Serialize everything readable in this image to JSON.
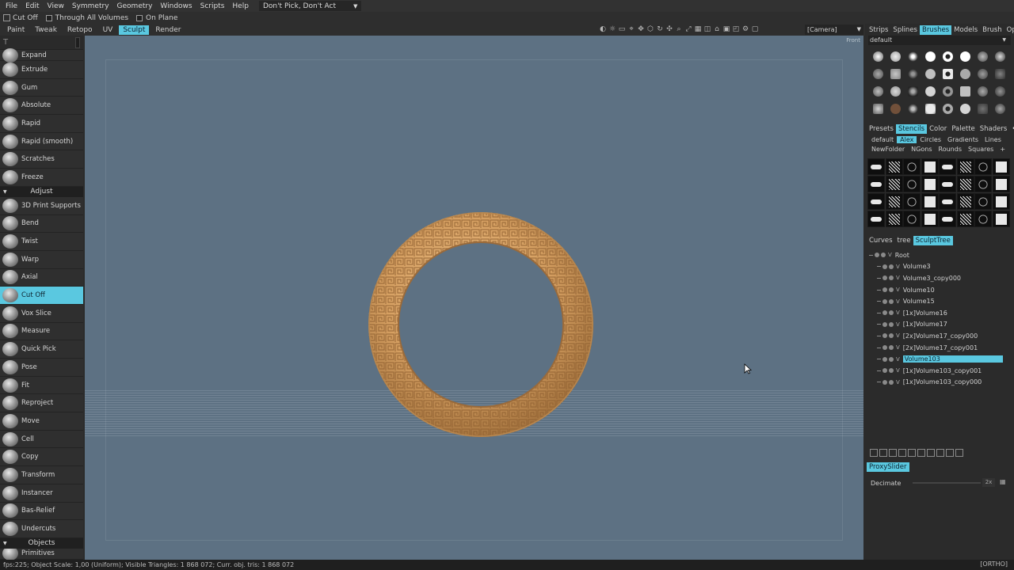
{
  "menu": {
    "items": [
      "File",
      "Edit",
      "View",
      "Symmetry",
      "Geometry",
      "Windows",
      "Scripts",
      "Help"
    ],
    "pick_mode": "Don't Pick, Don't Act"
  },
  "options": {
    "cut_off": "Cut Off",
    "through_all_volumes": "Through  All  Volumes",
    "on_plane": "On Plane"
  },
  "mode_tabs": [
    "Paint",
    "Tweak",
    "Retopo",
    "UV",
    "Sculpt",
    "Render"
  ],
  "active_mode": "Sculpt",
  "camera": "[Camera]",
  "viewport": {
    "view_label": "Front",
    "object_color": "#d6a062",
    "background": "#5d7183"
  },
  "left_panel": {
    "tools_top": [
      "Expand",
      "Extrude",
      "Gum",
      "Absolute",
      "Rapid",
      "Rapid  (smooth)",
      "Scratches",
      "Freeze"
    ],
    "section_adjust": "Adjust",
    "tools_adjust": [
      "3D  Print  Supports",
      "Bend",
      "Twist",
      "Warp",
      "Axial",
      "Cut Off",
      "Vox Slice",
      "Measure",
      "Quick Pick",
      "Pose",
      "Fit",
      "Reproject",
      "Move",
      "Cell",
      "Copy",
      "Transform",
      "Instancer",
      "Bas-Relief",
      "Undercuts"
    ],
    "active_tool": "Cut Off",
    "section_objects": "Objects",
    "tools_bottom": [
      "Primitives"
    ]
  },
  "right_panel": {
    "top_tabs": [
      "Strips",
      "Splines",
      "Brushes",
      "Models",
      "Brush",
      "Opti"
    ],
    "active_top_tab": "Brushes",
    "brush_preset": "default",
    "stencil_tabs": [
      "Presets",
      "Stencils",
      "Color",
      "Palette",
      "Shaders",
      "•••"
    ],
    "active_stencil_tab": "Stencils",
    "stencil_folders_row1": [
      "default",
      "Alex",
      "Circles",
      "Gradients",
      "Lines"
    ],
    "active_folder": "Alex",
    "stencil_folders_row2": [
      "NewFolder",
      "NGons",
      "Rounds",
      "Squares",
      "+"
    ],
    "tree_tabs": [
      "Curves",
      "tree",
      "SculptTree"
    ],
    "active_tree_tab": "SculptTree",
    "tree": [
      {
        "name": "Root",
        "root": true
      },
      {
        "name": "Volume3"
      },
      {
        "name": "Volume3_copy000"
      },
      {
        "name": "Volume10"
      },
      {
        "name": "Volume15"
      },
      {
        "name": "[1x]Volume16"
      },
      {
        "name": "[1x]Volume17"
      },
      {
        "name": "[2x]Volume17_copy000"
      },
      {
        "name": "[2x]Volume17_copy001"
      },
      {
        "name": "Volume103",
        "active": true
      },
      {
        "name": "[1x]Volume103_copy001"
      },
      {
        "name": "[1x]Volume103_copy000"
      }
    ],
    "proxy_tab": "ProxySlider",
    "decimate_label": "Decimate",
    "decimate_value": "2x",
    "accent": "#5ac8e0"
  },
  "status": {
    "text": "fps:225;       Object  Scale:  1,00  (Uniform);  Visible  Triangles:  1 868 072;  Curr.  obj.  tris:  1 868 072",
    "projection": "[ORTHO]"
  }
}
